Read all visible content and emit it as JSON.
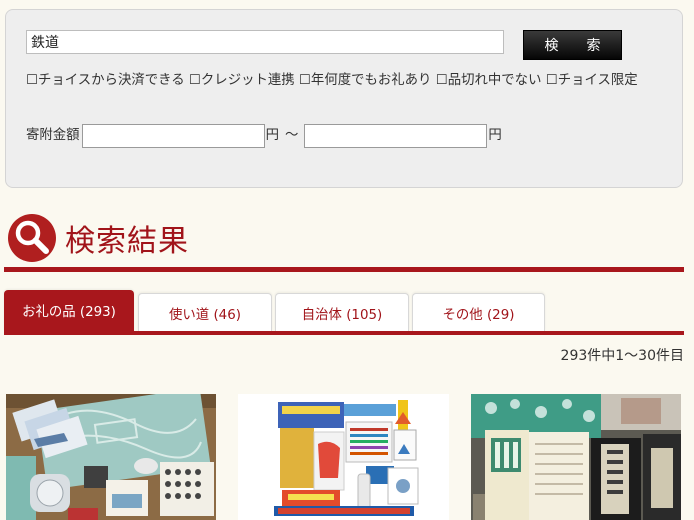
{
  "search": {
    "keyword": "鉄道",
    "button_label": "検　索",
    "options": [
      "☐チョイスから決済できる",
      "☐クレジット連携",
      "☐年何度でもお礼あり",
      "☐品切れ中でない",
      "☐チョイス限定"
    ],
    "amount_label": "寄附金額",
    "yen": "円",
    "range_sep": "～"
  },
  "results": {
    "title": "検索結果",
    "tabs": [
      {
        "label": "お礼の品 (293)",
        "active": true
      },
      {
        "label": "使い道 (46)",
        "active": false
      },
      {
        "label": "自治体 (105)",
        "active": false
      },
      {
        "label": "その他 (29)",
        "active": false
      }
    ],
    "count_text": "293件中1〜30件目"
  },
  "thumbnails": [
    {
      "name": "railway-towel-set"
    },
    {
      "name": "railway-goods-set"
    },
    {
      "name": "tsugaru-railway-food-set"
    }
  ],
  "colors": {
    "accent": "#a8171c",
    "background": "#fbf9f0",
    "search_panel": "#eeeeee"
  }
}
